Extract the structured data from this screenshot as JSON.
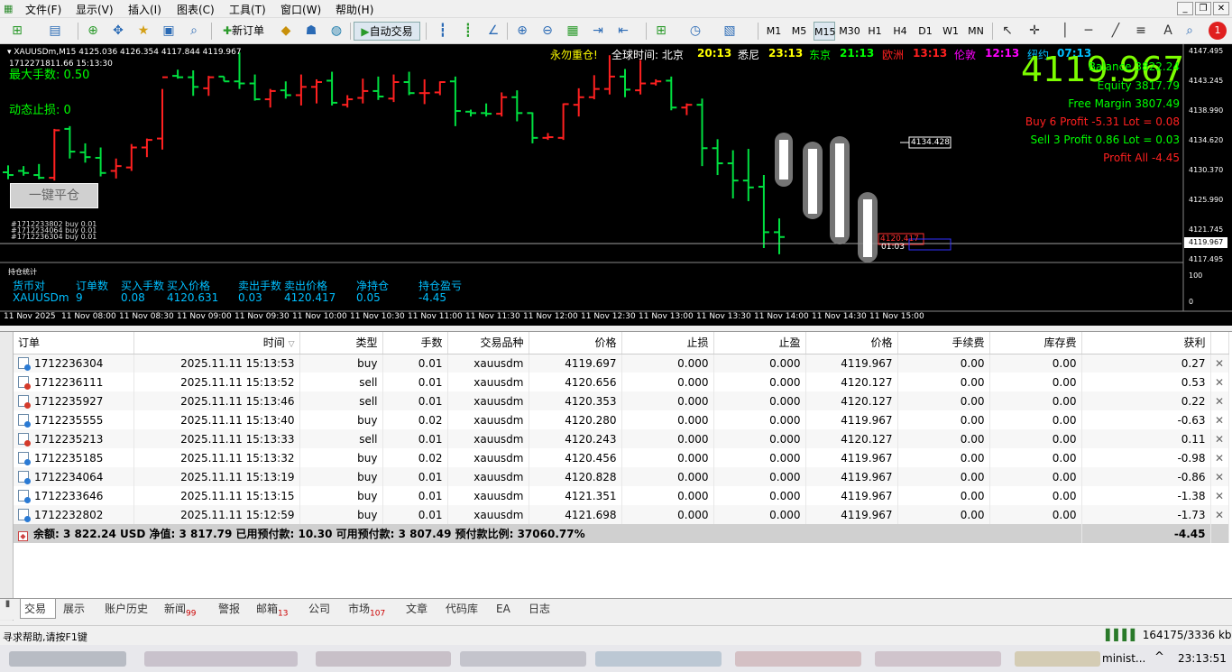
{
  "menu": {
    "items": [
      "文件(F)",
      "显示(V)",
      "插入(I)",
      "图表(C)",
      "工具(T)",
      "窗口(W)",
      "帮助(H)"
    ]
  },
  "toolbar": {
    "new_order": "新订单",
    "auto_trading": "自动交易",
    "timeframes": [
      "M1",
      "M5",
      "M15",
      "M30",
      "H1",
      "H4",
      "D1",
      "W1",
      "MN"
    ],
    "active_timeframe": "M15"
  },
  "chart": {
    "symbol_header": "XAUUSDm,M15  4125.036 4126.354 4117.844 4119.967",
    "subheader": "1712271811.66     15:13:30",
    "max_lots": "最大手数: 0.50",
    "dynamic_sl": "动态止损: 0",
    "close_all_button": "一键平仓",
    "reminder": "永勿重仓!",
    "world_time_label": "全球时间: 北京",
    "beijing_time": "20:13",
    "sydney_label": "悉尼",
    "sydney_time": "23:13",
    "tokyo_label": "东京",
    "tokyo_time": "21:13",
    "europe_label": "欧洲",
    "europe_time": "13:13",
    "london_label": "伦敦",
    "london_time": "12:13",
    "ny_label": "纽约",
    "ny_time": "07:13",
    "big_price": "4119.967",
    "balance": "Balance 3822.24",
    "equity": "Equity 3817.79",
    "free_margin": "Free Margin 3807.49",
    "buy_info": "Buy 6   Profit -5.31  Lot = 0.08",
    "sell_info": "Sell 3   Profit 0.86  Lot = 0.03",
    "profit_all": "Profit All -4.45",
    "price_box_1": "4134.428",
    "price_box_2": "4120.417",
    "timer": "01:03",
    "order_labels": [
      "#1712233802 buy 0.01",
      "#1712234064 buy 0.01",
      "#1712236304 buy 0.01"
    ],
    "price_scale": [
      "4147.495",
      "4143.245",
      "4138.990",
      "4134.620",
      "4130.370",
      "4125.990",
      "4121.745",
      "4119.967",
      "4117.495"
    ],
    "current_price": "4119.967",
    "sub_scale_top": "100",
    "sub_scale_bottom": "0",
    "time_axis": [
      "11 Nov 2025",
      "11 Nov 08:00",
      "11 Nov 08:30",
      "11 Nov 09:00",
      "11 Nov 09:30",
      "11 Nov 10:00",
      "11 Nov 10:30",
      "11 Nov 11:00",
      "11 Nov 11:30",
      "11 Nov 12:00",
      "11 Nov 12:30",
      "11 Nov 13:00",
      "11 Nov 13:30",
      "11 Nov 14:00",
      "11 Nov 14:30",
      "11 Nov 15:00"
    ],
    "stats": {
      "title": "持仓统计",
      "headers": [
        "货币对",
        "订单数",
        "买入手数",
        "买入价格",
        "卖出手数",
        "卖出价格",
        "净持仓",
        "持仓盈亏"
      ],
      "values": [
        "XAUUSDm",
        "9",
        "0.08",
        "4120.631",
        "0.03",
        "4120.417",
        "0.05",
        "-4.45"
      ]
    },
    "colors": {
      "bull": "#ff2020",
      "bear": "#00e040",
      "bg": "#000000"
    }
  },
  "chart_data": {
    "type": "bar",
    "series": [
      {
        "values": [
          [
            4129.4,
            4130.4,
            4128.4,
            4129.0
          ],
          [
            4129.6,
            4130.3,
            4128.9,
            4129.3
          ],
          [
            4129.0,
            4130.6,
            4128.4,
            4128.6
          ],
          [
            4128.6,
            4135.7,
            4128.2,
            4135.5
          ],
          [
            4135.7,
            4136.1,
            4131.4,
            4132.4
          ],
          [
            4132.3,
            4133.6,
            4130.8,
            4131.6
          ],
          [
            4131.5,
            4133.0,
            4128.8,
            4129.3
          ],
          [
            4129.6,
            4131.4,
            4128.5,
            4130.3
          ],
          [
            4130.1,
            4133.5,
            4129.6,
            4133.0
          ],
          [
            4133.0,
            4134.3,
            4131.6,
            4134.1
          ],
          [
            4134.3,
            4141.5,
            4132.7,
            4143.2
          ],
          [
            4143.4,
            4144.3,
            4143.0,
            4143.2
          ],
          [
            4143.2,
            4144.2,
            4140.5,
            4141.8
          ],
          [
            4141.6,
            4143.4,
            4140.5,
            4143.2
          ],
          [
            4143.3,
            4143.3,
            4142.6,
            4142.6
          ],
          [
            4142.6,
            4146.8,
            4141.5,
            4142.3
          ],
          [
            4142.3,
            4143.6,
            4139.8,
            4140.0
          ],
          [
            4140.0,
            4141.5,
            4138.8,
            4141.2
          ],
          [
            4141.3,
            4142.6,
            4140.1,
            4140.6
          ],
          [
            4140.6,
            4143.6,
            4139.1,
            4141.8
          ],
          [
            4141.8,
            4142.9,
            4139.4,
            4142.5
          ],
          [
            4142.7,
            4144.0,
            4139.1,
            4139.5
          ],
          [
            4139.2,
            4140.6,
            4138.8,
            4140.0
          ],
          [
            4140.2,
            4143.0,
            4139.4,
            4141.2
          ],
          [
            4141.2,
            4143.3,
            4139.9,
            4140.4
          ],
          [
            4140.1,
            4143.6,
            4139.6,
            4142.5
          ],
          [
            4142.5,
            4144.0,
            4140.6,
            4140.9
          ],
          [
            4140.9,
            4142.9,
            4139.3,
            4140.9
          ],
          [
            4141.0,
            4142.6,
            4140.6,
            4142.5
          ],
          [
            4142.6,
            4143.3,
            4136.1,
            4138.3
          ],
          [
            4138.2,
            4138.5,
            4137.5,
            4138.0
          ],
          [
            4138.0,
            4139.4,
            4137.5,
            4137.9
          ],
          [
            4137.9,
            4141.0,
            4137.5,
            4140.3
          ],
          [
            4140.3,
            4141.3,
            4136.8,
            4138.0
          ],
          [
            4138.0,
            4138.1,
            4133.6,
            4134.4
          ],
          [
            4134.4,
            4135.1,
            4134.1,
            4134.5
          ],
          [
            4134.4,
            4139.4,
            4134.1,
            4139.3
          ],
          [
            4139.2,
            4141.6,
            4137.5,
            4140.3
          ],
          [
            4140.3,
            4143.5,
            4140.0,
            4141.5
          ],
          [
            4141.5,
            4146.4,
            4140.7,
            4143.3
          ],
          [
            4143.3,
            4144.4,
            4140.3,
            4141.4
          ],
          [
            4141.3,
            4145.7,
            4140.7,
            4142.3
          ],
          [
            4142.3,
            4142.9,
            4142.0,
            4142.6
          ],
          [
            4142.7,
            4143.3,
            4138.4,
            4138.8
          ],
          [
            4138.8,
            4139.4,
            4137.7,
            4139.2
          ],
          [
            4139.2,
            4140.1,
            4130.3,
            4132.9
          ],
          [
            4132.9,
            4134.2,
            4129.0,
            4130.7
          ],
          [
            4130.7,
            4132.6,
            4125.6,
            4128.2
          ],
          [
            4128.2,
            4132.8,
            4125.2,
            4127.2
          ],
          [
            4127.3,
            4129.0,
            4118.4,
            4120.7
          ],
          [
            4120.7,
            4122.7,
            4117.5,
            4120.0
          ]
        ]
      }
    ],
    "x": [
      "11 Nov 2025",
      "11 Nov 08:00",
      "11 Nov 08:30",
      "11 Nov 09:00",
      "11 Nov 09:30",
      "11 Nov 10:00",
      "11 Nov 10:30",
      "11 Nov 11:00",
      "11 Nov 11:30",
      "11 Nov 12:00",
      "11 Nov 12:30",
      "11 Nov 13:00",
      "11 Nov 13:30",
      "11 Nov 14:00",
      "11 Nov 14:30",
      "11 Nov 15:00"
    ],
    "ylim": [
      4116.3,
      4148.0
    ],
    "title": "XAUUSDm,M15"
  },
  "terminal": {
    "columns": [
      "订单",
      "时间",
      "类型",
      "手数",
      "交易品种",
      "价格",
      "止损",
      "止盈",
      "价格",
      "手续费",
      "库存费",
      "获利"
    ],
    "rows": [
      {
        "ticket": "1712236304",
        "time": "2025.11.11 15:13:53",
        "type": "buy",
        "lots": "0.01",
        "symbol": "xauusdm",
        "open": "4119.697",
        "sl": "0.000",
        "tp": "0.000",
        "price": "4119.967",
        "comm": "0.00",
        "swap": "0.00",
        "profit": "0.27"
      },
      {
        "ticket": "1712236111",
        "time": "2025.11.11 15:13:52",
        "type": "sell",
        "lots": "0.01",
        "symbol": "xauusdm",
        "open": "4120.656",
        "sl": "0.000",
        "tp": "0.000",
        "price": "4120.127",
        "comm": "0.00",
        "swap": "0.00",
        "profit": "0.53"
      },
      {
        "ticket": "1712235927",
        "time": "2025.11.11 15:13:46",
        "type": "sell",
        "lots": "0.01",
        "symbol": "xauusdm",
        "open": "4120.353",
        "sl": "0.000",
        "tp": "0.000",
        "price": "4120.127",
        "comm": "0.00",
        "swap": "0.00",
        "profit": "0.22"
      },
      {
        "ticket": "1712235555",
        "time": "2025.11.11 15:13:40",
        "type": "buy",
        "lots": "0.02",
        "symbol": "xauusdm",
        "open": "4120.280",
        "sl": "0.000",
        "tp": "0.000",
        "price": "4119.967",
        "comm": "0.00",
        "swap": "0.00",
        "profit": "-0.63"
      },
      {
        "ticket": "1712235213",
        "time": "2025.11.11 15:13:33",
        "type": "sell",
        "lots": "0.01",
        "symbol": "xauusdm",
        "open": "4120.243",
        "sl": "0.000",
        "tp": "0.000",
        "price": "4120.127",
        "comm": "0.00",
        "swap": "0.00",
        "profit": "0.11"
      },
      {
        "ticket": "1712235185",
        "time": "2025.11.11 15:13:32",
        "type": "buy",
        "lots": "0.02",
        "symbol": "xauusdm",
        "open": "4120.456",
        "sl": "0.000",
        "tp": "0.000",
        "price": "4119.967",
        "comm": "0.00",
        "swap": "0.00",
        "profit": "-0.98"
      },
      {
        "ticket": "1712234064",
        "time": "2025.11.11 15:13:19",
        "type": "buy",
        "lots": "0.01",
        "symbol": "xauusdm",
        "open": "4120.828",
        "sl": "0.000",
        "tp": "0.000",
        "price": "4119.967",
        "comm": "0.00",
        "swap": "0.00",
        "profit": "-0.86"
      },
      {
        "ticket": "1712233646",
        "time": "2025.11.11 15:13:15",
        "type": "buy",
        "lots": "0.01",
        "symbol": "xauusdm",
        "open": "4121.351",
        "sl": "0.000",
        "tp": "0.000",
        "price": "4119.967",
        "comm": "0.00",
        "swap": "0.00",
        "profit": "-1.38"
      },
      {
        "ticket": "1712232802",
        "time": "2025.11.11 15:12:59",
        "type": "buy",
        "lots": "0.01",
        "symbol": "xauusdm",
        "open": "4121.698",
        "sl": "0.000",
        "tp": "0.000",
        "price": "4119.967",
        "comm": "0.00",
        "swap": "0.00",
        "profit": "-1.73"
      }
    ],
    "summary": "余额: 3 822.24 USD  净值: 3 817.79  已用预付款: 10.30  可用预付款: 3 807.49  预付款比例: 37060.77%",
    "summary_profit": "-4.45"
  },
  "tabs": [
    {
      "label": "交易",
      "badge": ""
    },
    {
      "label": "展示",
      "badge": ""
    },
    {
      "label": "账户历史",
      "badge": ""
    },
    {
      "label": "新闻",
      "badge": "99"
    },
    {
      "label": "警报",
      "badge": ""
    },
    {
      "label": "邮箱",
      "badge": "13"
    },
    {
      "label": "公司",
      "badge": ""
    },
    {
      "label": "市场",
      "badge": "107"
    },
    {
      "label": "文章",
      "badge": ""
    },
    {
      "label": "代码库",
      "badge": ""
    },
    {
      "label": "EA",
      "badge": ""
    },
    {
      "label": "日志",
      "badge": ""
    }
  ],
  "status": {
    "help": "寻求帮助,请按F1键",
    "traffic": "164175/3336 kb"
  },
  "taskbar": {
    "user": "minist...",
    "clock": "23:13:51"
  },
  "notification_badge": "1"
}
